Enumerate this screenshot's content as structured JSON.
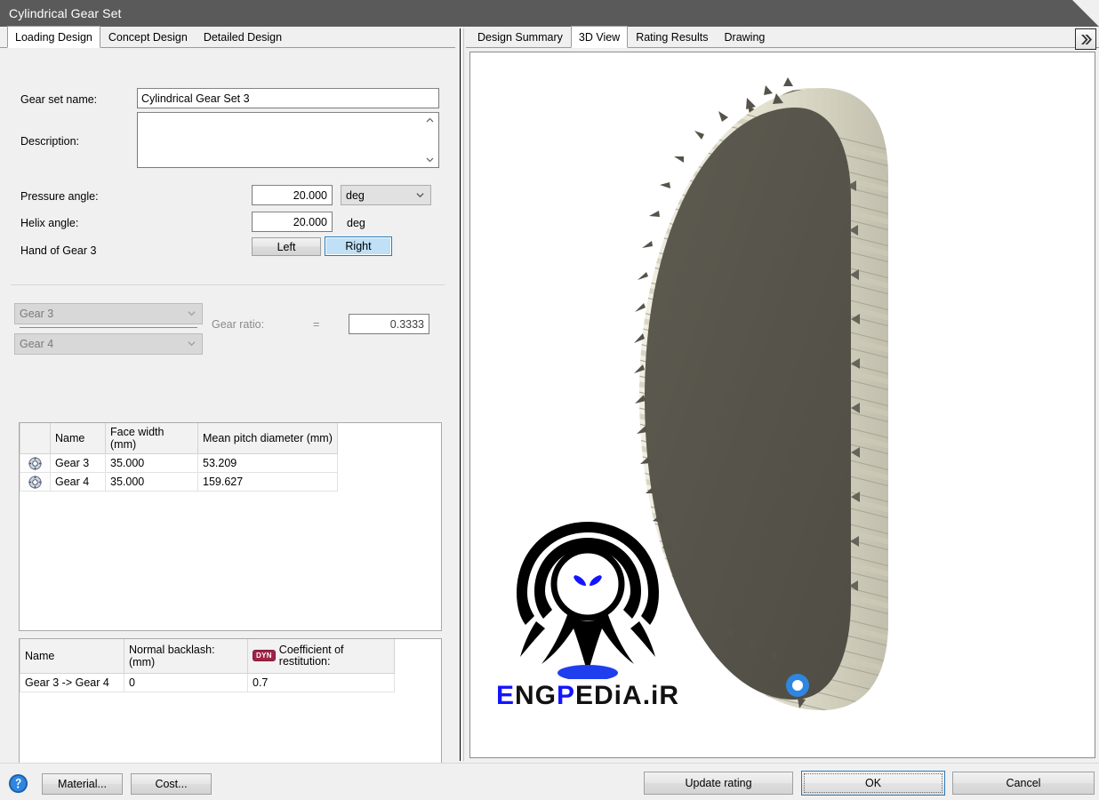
{
  "window": {
    "title": "Cylindrical Gear Set"
  },
  "left_tabs": [
    {
      "label": "Loading Design",
      "active": true
    },
    {
      "label": "Concept Design",
      "active": false
    },
    {
      "label": "Detailed Design",
      "active": false
    }
  ],
  "right_tabs": [
    {
      "label": "Design Summary",
      "active": false
    },
    {
      "label": "3D View",
      "active": true
    },
    {
      "label": "Rating Results",
      "active": false
    },
    {
      "label": "Drawing",
      "active": false
    }
  ],
  "form": {
    "gear_set_name_label": "Gear set name:",
    "gear_set_name_value": "Cylindrical Gear Set 3",
    "gear_set_name_placeholder": "",
    "description_label": "Description:",
    "description_value": "",
    "description_placeholder": "",
    "pressure_angle_label": "Pressure angle:",
    "pressure_angle_value": "20.000",
    "pressure_angle_unit": "deg",
    "helix_angle_label": "Helix angle:",
    "helix_angle_value": "20.000",
    "helix_angle_unit": "deg",
    "hand_of_gear_label": "Hand of Gear 3",
    "hand_left_label": "Left",
    "hand_right_label": "Right",
    "hand_selected": "Right"
  },
  "ratio": {
    "numerator_value": "Gear 3",
    "denominator_value": "Gear 4",
    "label": "Gear ratio:",
    "equals": "=",
    "value": "0.3333"
  },
  "gear_table": {
    "columns": [
      "",
      "Name",
      "Face width (mm)",
      "Mean pitch diameter (mm)",
      ""
    ],
    "rows": [
      {
        "icon": "gear-icon",
        "name": "Gear 3",
        "face_width": "35.000",
        "mean_pitch_diameter": "53.209"
      },
      {
        "icon": "gear-icon",
        "name": "Gear 4",
        "face_width": "35.000",
        "mean_pitch_diameter": "159.627"
      }
    ]
  },
  "mesh_table": {
    "columns": [
      "Name",
      "Normal backlash: (mm)",
      "Coefficient of restitution:"
    ],
    "badge": "DYN",
    "rows": [
      {
        "name": "Gear 3 -> Gear 4",
        "normal_backlash": "0",
        "coefficient_of_restitution": "0.7"
      }
    ]
  },
  "viewer": {
    "expand_icon": "chevron-double-right-icon",
    "watermark_text_parts": [
      {
        "t": "E",
        "c": "blue"
      },
      {
        "t": "N",
        "c": "black"
      },
      {
        "t": "G",
        "c": "black"
      },
      {
        "t": "P",
        "c": "blue"
      },
      {
        "t": "E",
        "c": "black"
      },
      {
        "t": "D",
        "c": "black"
      },
      {
        "t": "i",
        "c": "black"
      },
      {
        "t": "A",
        "c": "black"
      },
      {
        "t": ".",
        "c": "black"
      },
      {
        "t": "i",
        "c": "black"
      },
      {
        "t": "R",
        "c": "black"
      }
    ],
    "watermark_text": "ENGPEDiA.iR"
  },
  "footer": {
    "help_icon": "help-icon",
    "material_label": "Material...",
    "cost_label": "Cost...",
    "update_rating_label": "Update rating",
    "ok_label": "OK",
    "cancel_label": "Cancel"
  },
  "colors": {
    "titlebar": "#5a5a5a",
    "accent_blue": "#2a7ab9",
    "selected_fill": "#bfe0f5",
    "dyn_badge": "#a02346",
    "gear_body": "#5a584e",
    "gear_teeth": "#e8e6d8",
    "marker_blue": "#2f86e0",
    "watermark_blue": "#1414ff"
  }
}
